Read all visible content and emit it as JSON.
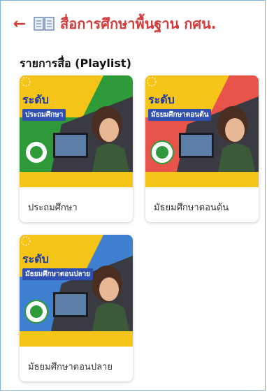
{
  "header": {
    "back_icon": "arrow-left-icon",
    "book_icon": "open-book-icon",
    "title": "สื่อการศึกษาพื้นฐาน กศน."
  },
  "section": {
    "title": "รายการสื่อ (Playlist)"
  },
  "cards": [
    {
      "label": "ประถมศึกษา",
      "badge_level": "ระดับ",
      "badge_sub": "ประถมศึกษา",
      "color": "#2f9a3a"
    },
    {
      "label": "มัธยมศึกษาตอนต้น",
      "badge_level": "ระดับ",
      "badge_sub": "มัธยมศึกษาตอนต้น",
      "color": "#e8534a"
    },
    {
      "label": "มัธยมศึกษาตอนปลาย",
      "badge_level": "ระดับ",
      "badge_sub": "มัธยมศึกษาตอนปลาย",
      "color": "#3f7fd0"
    }
  ],
  "colors": {
    "accent": "#d33b3b",
    "yellow": "#f5c419",
    "navy": "#1d3a99"
  }
}
